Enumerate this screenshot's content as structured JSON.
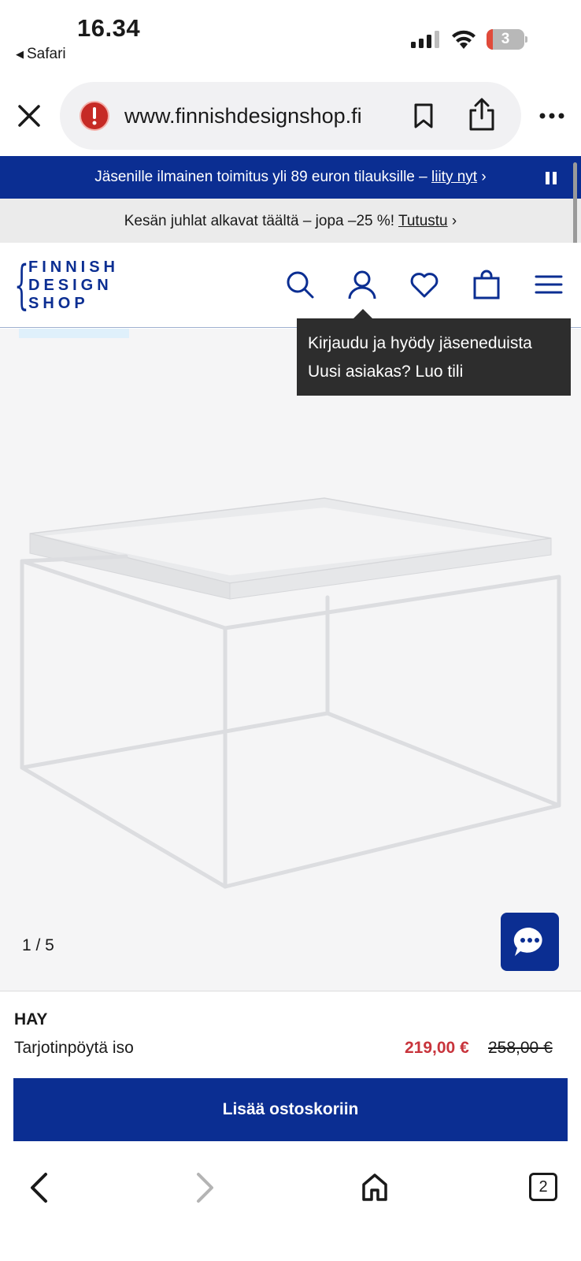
{
  "status_bar": {
    "time": "16.34",
    "back_app": "Safari",
    "battery_level": "3"
  },
  "browser": {
    "url": "www.finnishdesignshop.fi",
    "icons": [
      "close-icon",
      "security-warning-icon",
      "bookmark-icon",
      "share-icon",
      "more-icon"
    ]
  },
  "promo": {
    "blue_text": "Jäsenille ilmainen toimitus yli 89 euron tilauksille – ",
    "blue_link": "liity nyt",
    "blue_chevron": " ›",
    "grey_text": "Kesän juhlat alkavat täältä – jopa –25 %! ",
    "grey_link": "Tutustu",
    "grey_chevron": " ›"
  },
  "header": {
    "logo_lines": [
      "FINNISH",
      "DESIGN",
      "SHOP"
    ],
    "icons": [
      "search-icon",
      "user-icon",
      "heart-icon",
      "bag-icon",
      "menu-icon"
    ]
  },
  "tooltip": {
    "line1": "Kirjaudu ja hyödy jäseneduista",
    "line2": "Uusi asiakas? Luo tili"
  },
  "gallery": {
    "counter": "1 / 5",
    "current": 1,
    "total": 5
  },
  "product": {
    "brand": "HAY",
    "name": "Tarjotinpöytä iso",
    "price_sale": "219,00 €",
    "price_old": "258,00 €",
    "add_to_cart": "Lisää ostoskoriin"
  },
  "bottom_nav": {
    "tab_count": "2",
    "icons": [
      "back-icon",
      "forward-icon",
      "home-icon",
      "tabs-icon"
    ]
  },
  "colors": {
    "brand_blue": "#0b2e92",
    "sale_red": "#c8343c",
    "tooltip_bg": "#2d2d2d"
  }
}
